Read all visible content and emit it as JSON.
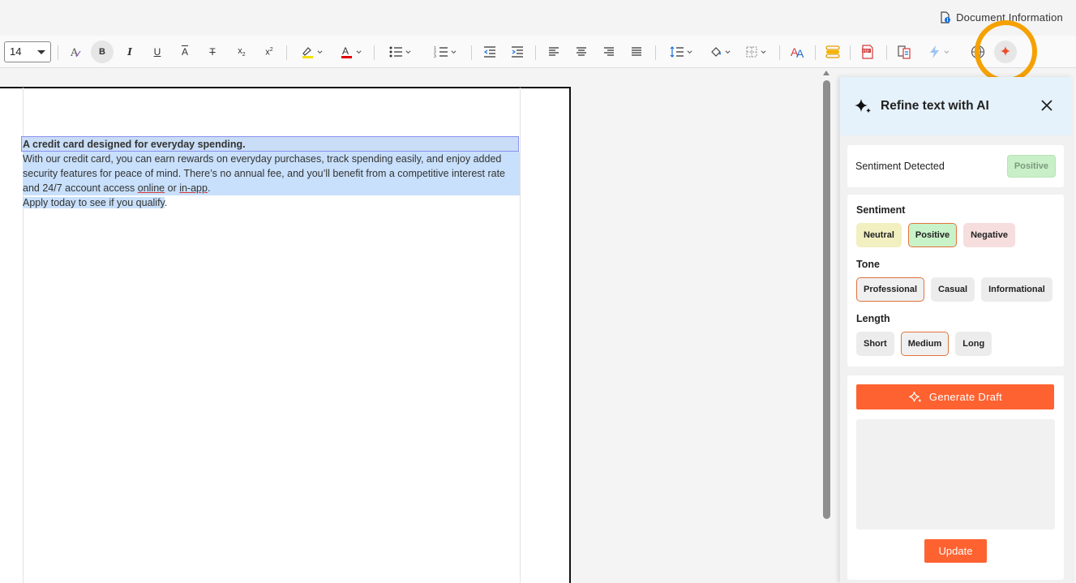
{
  "header": {
    "doc_info_label": "Document Information"
  },
  "toolbar": {
    "font_size": "14",
    "subscript_label": "x",
    "subscript_mark": "2",
    "superscript_label": "x",
    "superscript_mark": "2"
  },
  "document": {
    "title": "A credit card designed for everyday spending",
    "title_end": ".",
    "body_part1": "With our credit card, you can earn rewards on everyday purchases, track spending easily, and enjoy added security features for peace of mind. There’s no annual fee, and you’ll benefit from a competitive interest rate and 24/7 account access ",
    "body_online": "online",
    "body_or": " or ",
    "body_inapp": "in-app",
    "body_end": ".",
    "cta": "Apply today to see if you qualify",
    "cta_end": "."
  },
  "panel": {
    "title": "Refine text with AI",
    "sentiment_detected_label": "Sentiment Detected",
    "sentiment_detected_value": "Positive",
    "sentiment": {
      "label": "Sentiment",
      "options": [
        "Neutral",
        "Positive",
        "Negative"
      ],
      "selected": "Positive"
    },
    "tone": {
      "label": "Tone",
      "options": [
        "Professional",
        "Casual",
        "Informational"
      ],
      "selected": "Professional"
    },
    "length": {
      "label": "Length",
      "options": [
        "Short",
        "Medium",
        "Long"
      ],
      "selected": "Medium"
    },
    "generate_label": "Generate Draft",
    "update_label": "Update"
  },
  "colors": {
    "accent": "#fe6230",
    "highlight_ring": "#f5a100",
    "selection": "#c8e0fb"
  }
}
